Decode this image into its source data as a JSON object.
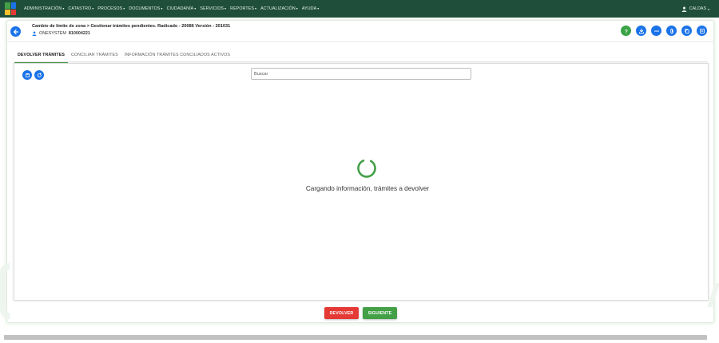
{
  "navbar": {
    "menu": [
      {
        "label": "ADMINISTRACIÓN"
      },
      {
        "label": "CATASTRO"
      },
      {
        "label": "PROCESOS"
      },
      {
        "label": "DOCUMENTOS"
      },
      {
        "label": "CIUDADANÍA"
      },
      {
        "label": "SERVICIOS"
      },
      {
        "label": "REPORTES"
      },
      {
        "label": "ACTUALIZACIÓN"
      },
      {
        "label": "AYUDA"
      }
    ],
    "user": "CALDAS",
    "colors": {
      "bar": "#1f4f3b",
      "logo": [
        "#43a047",
        "#1a73e8",
        "#fbc02d",
        "#e53935"
      ]
    }
  },
  "header": {
    "title": "Cambio de límite de zona  >  Gestionar trámites pendientes. Radicado - 20086 Versión - 201031",
    "subtitle_name": "ONESYSTEM",
    "subtitle_code": "810004221",
    "action_icons": [
      "help-icon",
      "download-icon",
      "more-icon",
      "attach-icon",
      "copy-icon",
      "notes-icon"
    ]
  },
  "tabs": [
    {
      "label": "DEVOLVER TRÁMITES",
      "active": true
    },
    {
      "label": "CONCILIAR TRÁMITES",
      "active": false
    },
    {
      "label": "INFORMACIÓN TRÁMITES CONCILIADOS ACTIVOS",
      "active": false
    }
  ],
  "panel": {
    "search_placeholder": "Buscar",
    "tools": [
      "save-icon",
      "refresh-icon"
    ],
    "loading_text": "Cargando información, trámites a devolver"
  },
  "buttons": {
    "devolver": "DEVOLVER",
    "siguiente": "SIGUIENTE"
  },
  "colors": {
    "primary": "#1a73e8",
    "success": "#43a047",
    "danger": "#e53935"
  }
}
